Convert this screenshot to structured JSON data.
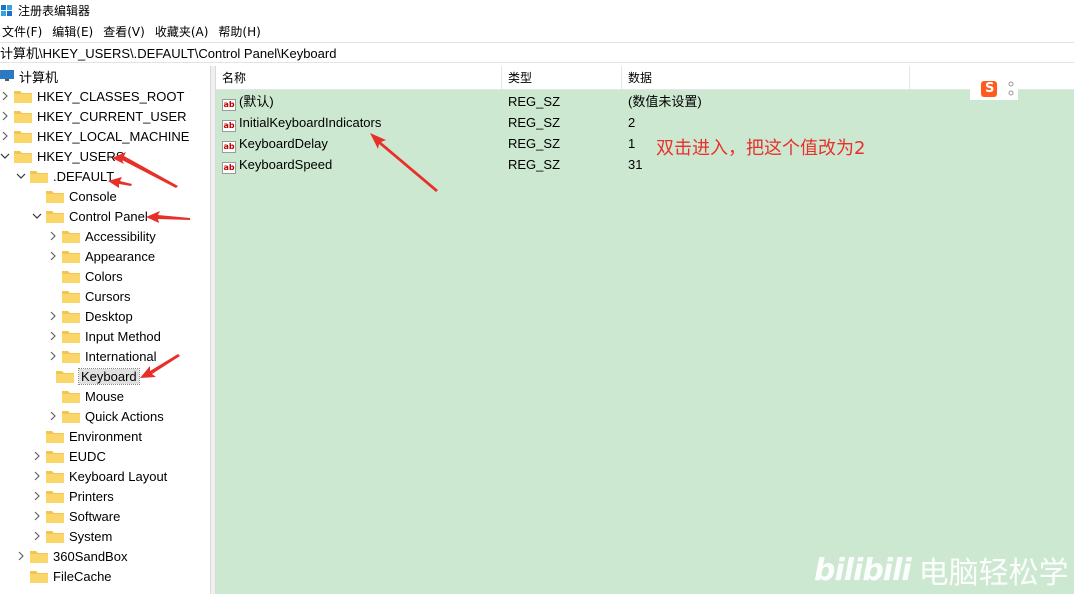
{
  "window": {
    "title": "注册表编辑器",
    "icon": "registry-editor-icon"
  },
  "menu": [
    "文件(F)",
    "编辑(E)",
    "查看(V)",
    "收藏夹(A)",
    "帮助(H)"
  ],
  "address": "计算机\\HKEY_USERS\\.DEFAULT\\Control Panel\\Keyboard",
  "tree": {
    "root_label": "计算机",
    "items": [
      {
        "label": "HKEY_CLASSES_ROOT"
      },
      {
        "label": "HKEY_CURRENT_USER"
      },
      {
        "label": "HKEY_LOCAL_MACHINE"
      },
      {
        "label": "HKEY_USERS"
      },
      {
        "label": ".DEFAULT"
      },
      {
        "label": "Console"
      },
      {
        "label": "Control Panel"
      },
      {
        "label": "Accessibility"
      },
      {
        "label": "Appearance"
      },
      {
        "label": "Colors"
      },
      {
        "label": "Cursors"
      },
      {
        "label": "Desktop"
      },
      {
        "label": "Input Method"
      },
      {
        "label": "International"
      },
      {
        "label": "Keyboard"
      },
      {
        "label": "Mouse"
      },
      {
        "label": "Quick Actions"
      },
      {
        "label": "Environment"
      },
      {
        "label": "EUDC"
      },
      {
        "label": "Keyboard Layout"
      },
      {
        "label": "Printers"
      },
      {
        "label": "Software"
      },
      {
        "label": "System"
      },
      {
        "label": "360SandBox"
      },
      {
        "label": "FileCache"
      }
    ]
  },
  "columns": [
    "名称",
    "类型",
    "数据"
  ],
  "values": [
    {
      "name": "(默认)",
      "type": "REG_SZ",
      "data": "(数值未设置)"
    },
    {
      "name": "InitialKeyboardIndicators",
      "type": "REG_SZ",
      "data": "2"
    },
    {
      "name": "KeyboardDelay",
      "type": "REG_SZ",
      "data": "1"
    },
    {
      "name": "KeyboardSpeed",
      "type": "REG_SZ",
      "data": "31"
    }
  ],
  "value_icon_text": "ab",
  "annotation": "双击进入，把这个值改为2",
  "ime_logo": "S",
  "watermark": {
    "logo": "bilibili",
    "text": "电脑轻松学"
  },
  "colors": {
    "list_bg": "#cde8d1",
    "annotation": "#e8302a",
    "folder": "#f5c64f"
  }
}
